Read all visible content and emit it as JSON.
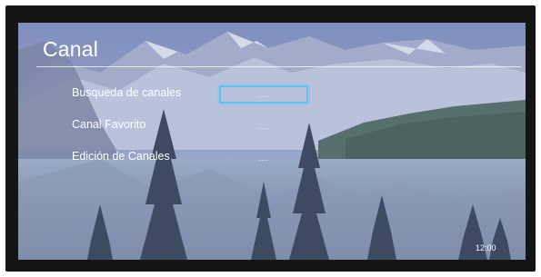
{
  "screen": {
    "title": "Canal",
    "clock": "12:00"
  },
  "menu": {
    "items": [
      {
        "label": "Busqueda de canales",
        "value": "...",
        "focused": true
      },
      {
        "label": "Canal Favorito",
        "value": "...",
        "focused": false
      },
      {
        "label": "Edición de Canales",
        "value": "...",
        "focused": false
      }
    ]
  },
  "colors": {
    "focus_border": "#5fc2ec",
    "text": "#ffffff",
    "bezel": "#151515"
  }
}
